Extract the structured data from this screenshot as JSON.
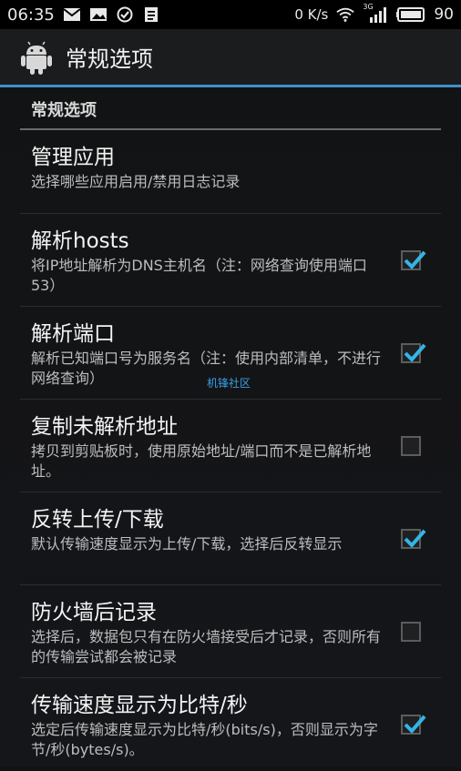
{
  "status_bar": {
    "time": "06:35",
    "net_speed": "0 K/s",
    "network": "3G",
    "battery": "90"
  },
  "action_bar": {
    "title": "常规选项"
  },
  "section": {
    "title": "常规选项"
  },
  "preferences": [
    {
      "title": "管理应用",
      "summary": "选择哪些应用启用/禁用日志记录",
      "has_checkbox": false,
      "checked": false
    },
    {
      "title": "解析hosts",
      "summary": "将IP地址解析为DNS主机名（注：网络查询使用端口53）",
      "has_checkbox": true,
      "checked": true
    },
    {
      "title": "解析端口",
      "summary": "解析已知端口号为服务名（注：使用内部清单，不进行网络查询）",
      "has_checkbox": true,
      "checked": true
    },
    {
      "title": "复制未解析地址",
      "summary": "拷贝到剪贴板时，使用原始地址/端口而不是已解析地址。",
      "has_checkbox": true,
      "checked": false
    },
    {
      "title": "反转上传/下载",
      "summary": "默认传输速度显示为上传/下载，选择后反转显示",
      "has_checkbox": true,
      "checked": true
    },
    {
      "title": "防火墙后记录",
      "summary": "选择后，数据包只有在防火墙接受后才记录，否则所有的传输尝试都会被记录",
      "has_checkbox": true,
      "checked": false
    },
    {
      "title": "传输速度显示为比特/秒",
      "summary": "选定后传输速度显示为比特/秒(bits/s)，否则显示为字节/秒(bytes/s)。",
      "has_checkbox": true,
      "checked": true
    }
  ],
  "watermark": "机锋社区",
  "colors": {
    "accent": "#3d91c9",
    "check": "#33b5e5"
  },
  "icons": [
    "mail-icon",
    "picture-icon",
    "check-circle-icon",
    "clipboard-icon",
    "wifi-icon",
    "signal-icon",
    "battery-icon",
    "android-icon"
  ]
}
